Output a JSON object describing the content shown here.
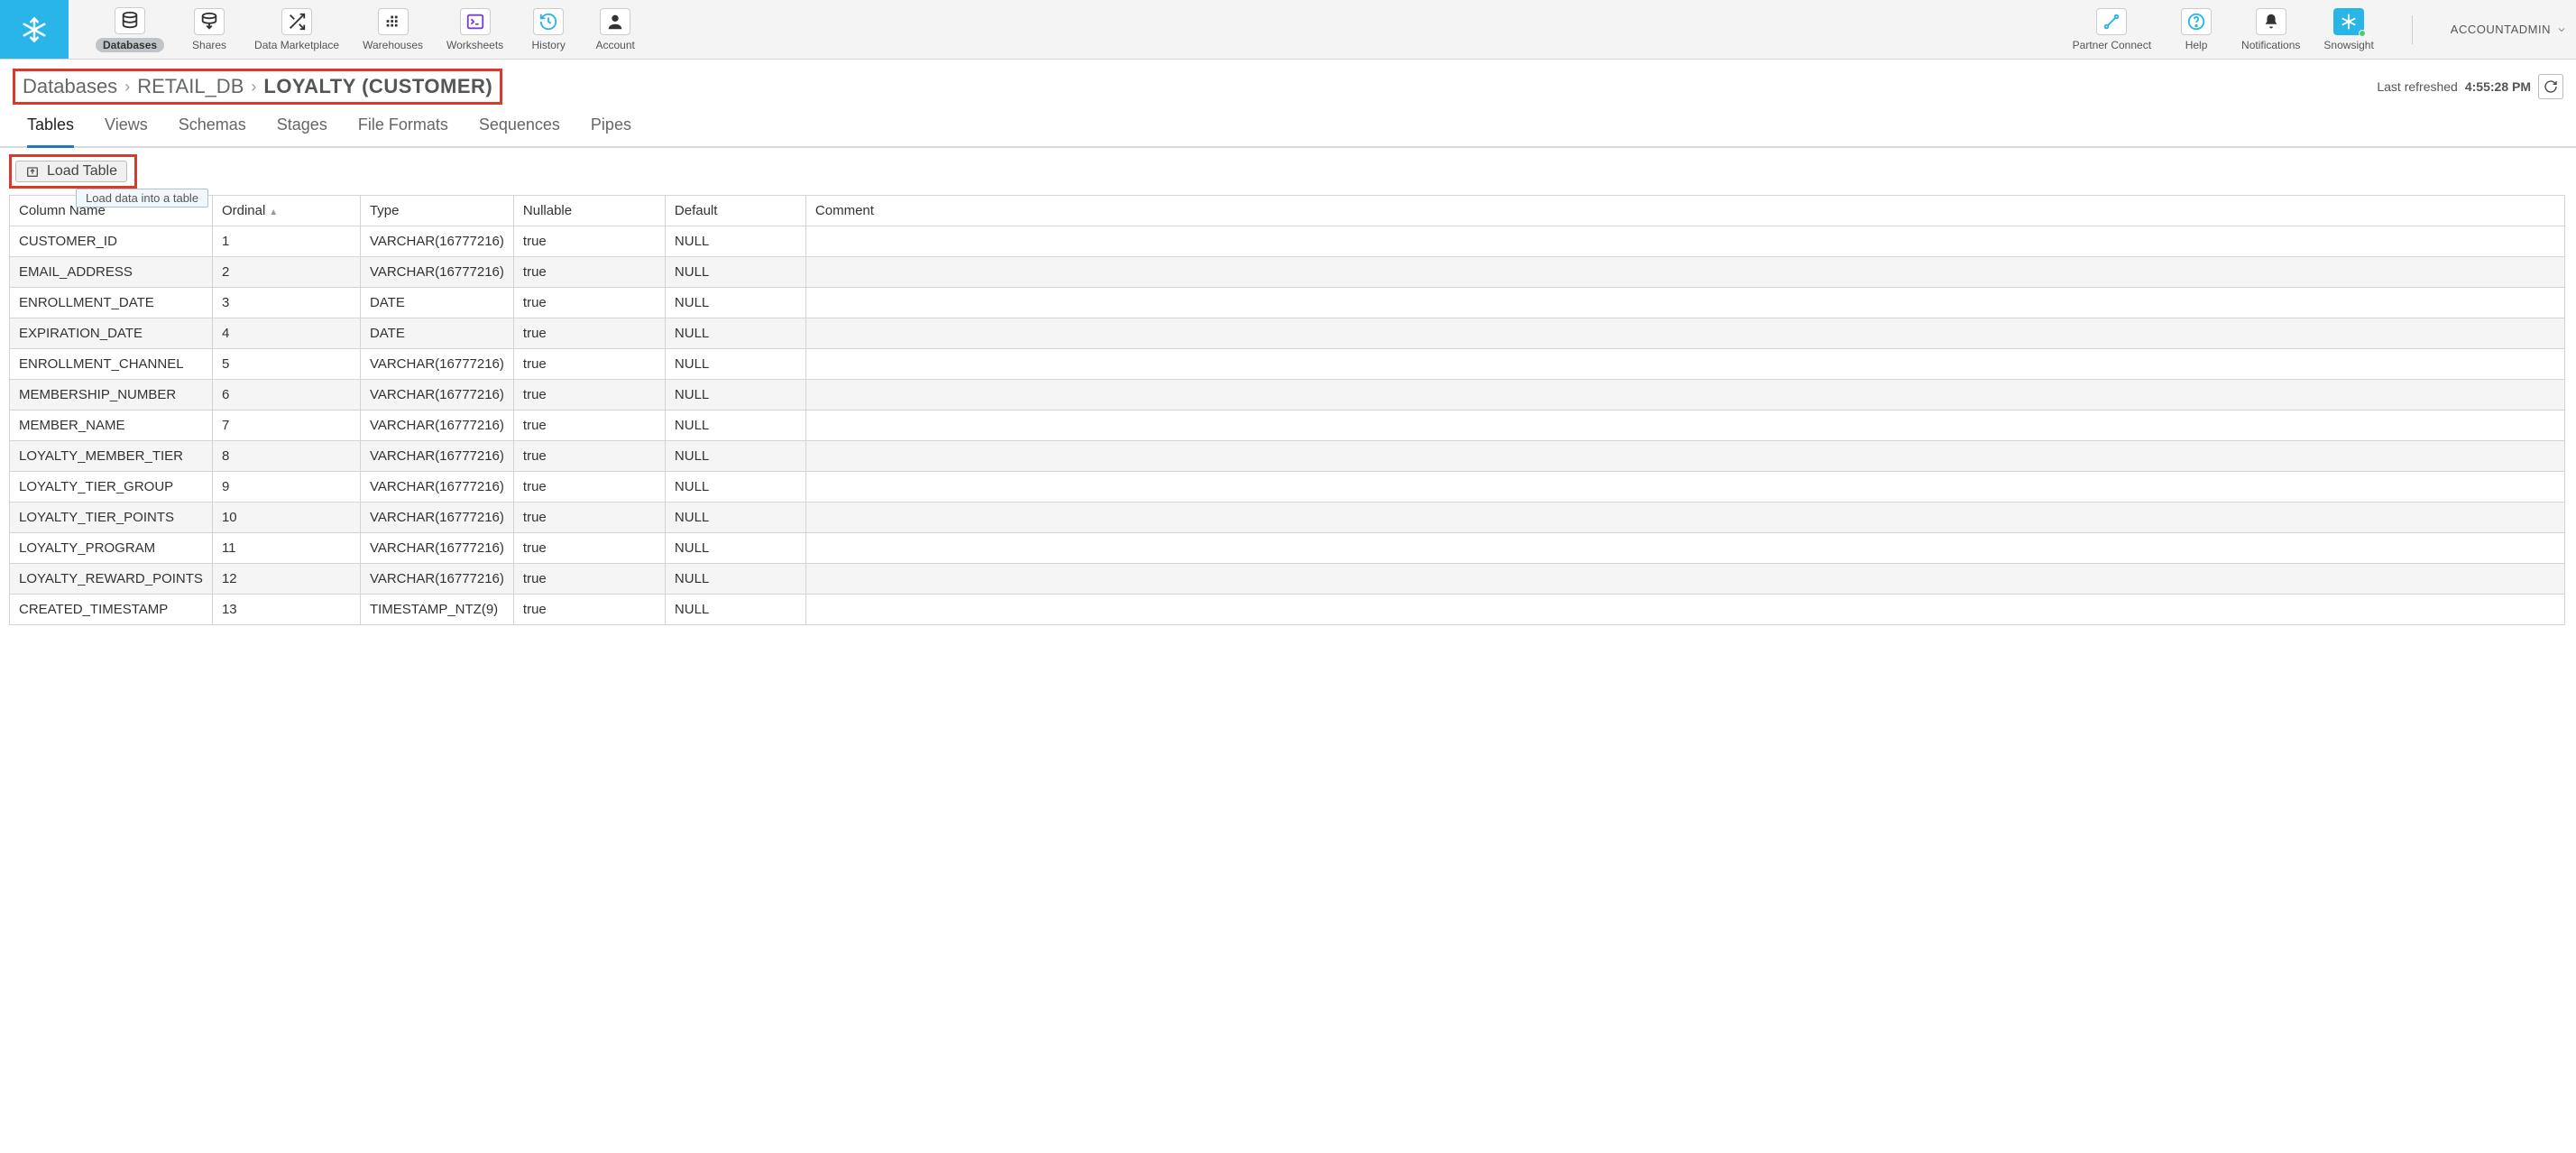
{
  "nav": {
    "items": [
      {
        "label": "Databases"
      },
      {
        "label": "Shares"
      },
      {
        "label": "Data Marketplace"
      },
      {
        "label": "Warehouses"
      },
      {
        "label": "Worksheets"
      },
      {
        "label": "History"
      },
      {
        "label": "Account"
      }
    ],
    "right": [
      {
        "label": "Partner Connect"
      },
      {
        "label": "Help"
      },
      {
        "label": "Notifications"
      },
      {
        "label": "Snowsight"
      }
    ],
    "account": "ACCOUNTADMIN"
  },
  "breadcrumb": {
    "root": "Databases",
    "db": "RETAIL_DB",
    "current": "LOYALTY (CUSTOMER)"
  },
  "refresh": {
    "label": "Last refreshed",
    "time": "4:55:28 PM"
  },
  "tabs": [
    "Tables",
    "Views",
    "Schemas",
    "Stages",
    "File Formats",
    "Sequences",
    "Pipes"
  ],
  "load_button": "Load Table",
  "tooltip": "Load data into a table",
  "headers": {
    "name": "Column Name",
    "ordinal": "Ordinal",
    "type": "Type",
    "nullable": "Nullable",
    "default": "Default",
    "comment": "Comment"
  },
  "rows": [
    {
      "name": "CUSTOMER_ID",
      "ordinal": "1",
      "type": "VARCHAR(16777216)",
      "nullable": "true",
      "default": "NULL",
      "comment": ""
    },
    {
      "name": "EMAIL_ADDRESS",
      "ordinal": "2",
      "type": "VARCHAR(16777216)",
      "nullable": "true",
      "default": "NULL",
      "comment": ""
    },
    {
      "name": "ENROLLMENT_DATE",
      "ordinal": "3",
      "type": "DATE",
      "nullable": "true",
      "default": "NULL",
      "comment": ""
    },
    {
      "name": "EXPIRATION_DATE",
      "ordinal": "4",
      "type": "DATE",
      "nullable": "true",
      "default": "NULL",
      "comment": ""
    },
    {
      "name": "ENROLLMENT_CHANNEL",
      "ordinal": "5",
      "type": "VARCHAR(16777216)",
      "nullable": "true",
      "default": "NULL",
      "comment": ""
    },
    {
      "name": "MEMBERSHIP_NUMBER",
      "ordinal": "6",
      "type": "VARCHAR(16777216)",
      "nullable": "true",
      "default": "NULL",
      "comment": ""
    },
    {
      "name": "MEMBER_NAME",
      "ordinal": "7",
      "type": "VARCHAR(16777216)",
      "nullable": "true",
      "default": "NULL",
      "comment": ""
    },
    {
      "name": "LOYALTY_MEMBER_TIER",
      "ordinal": "8",
      "type": "VARCHAR(16777216)",
      "nullable": "true",
      "default": "NULL",
      "comment": ""
    },
    {
      "name": "LOYALTY_TIER_GROUP",
      "ordinal": "9",
      "type": "VARCHAR(16777216)",
      "nullable": "true",
      "default": "NULL",
      "comment": ""
    },
    {
      "name": "LOYALTY_TIER_POINTS",
      "ordinal": "10",
      "type": "VARCHAR(16777216)",
      "nullable": "true",
      "default": "NULL",
      "comment": ""
    },
    {
      "name": "LOYALTY_PROGRAM",
      "ordinal": "11",
      "type": "VARCHAR(16777216)",
      "nullable": "true",
      "default": "NULL",
      "comment": ""
    },
    {
      "name": "LOYALTY_REWARD_POINTS",
      "ordinal": "12",
      "type": "VARCHAR(16777216)",
      "nullable": "true",
      "default": "NULL",
      "comment": ""
    },
    {
      "name": "CREATED_TIMESTAMP",
      "ordinal": "13",
      "type": "TIMESTAMP_NTZ(9)",
      "nullable": "true",
      "default": "NULL",
      "comment": ""
    }
  ]
}
